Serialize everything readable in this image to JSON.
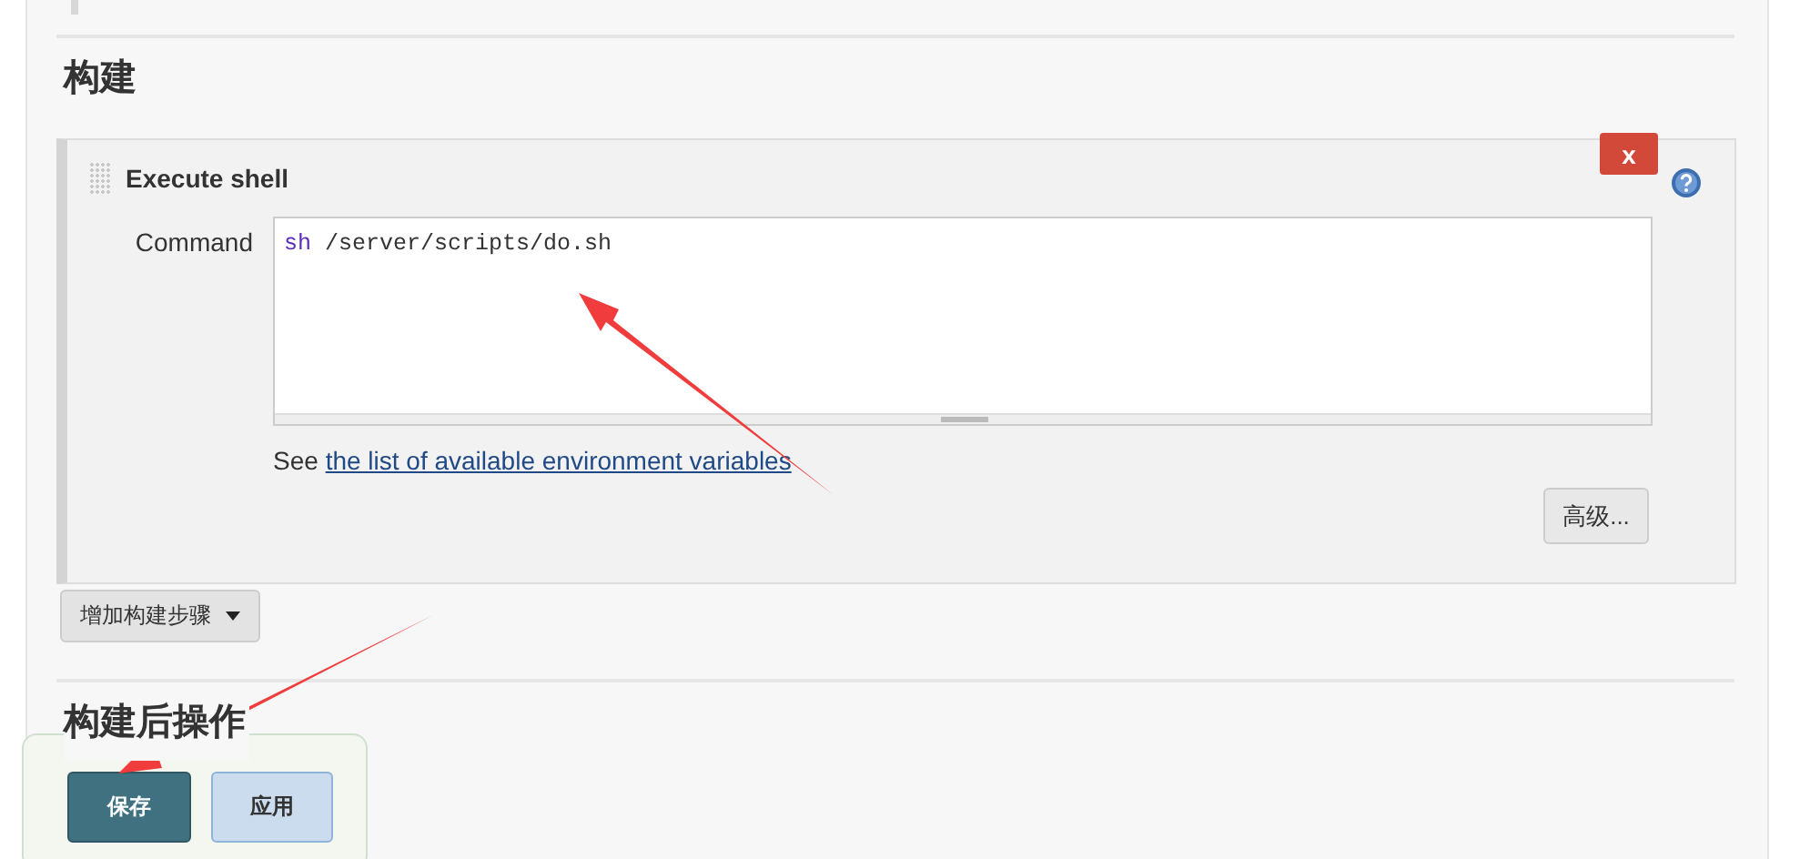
{
  "section_heading": "构建",
  "build_step": {
    "title": "Execute shell",
    "command_label": "Command",
    "command": {
      "keyword": "sh",
      "args": "/server/scripts/do.sh"
    },
    "hint": "See",
    "hint_link": "the list of available environment variables",
    "advanced_button": "高级...",
    "delete_button": "x"
  },
  "add_step_button": "增加构建步骤",
  "post_build_heading": "构建后操作",
  "save_bar": {
    "buttons": [
      {
        "label": "保存",
        "kind": "primary"
      },
      {
        "label": "应用",
        "kind": "secondary"
      }
    ]
  }
}
